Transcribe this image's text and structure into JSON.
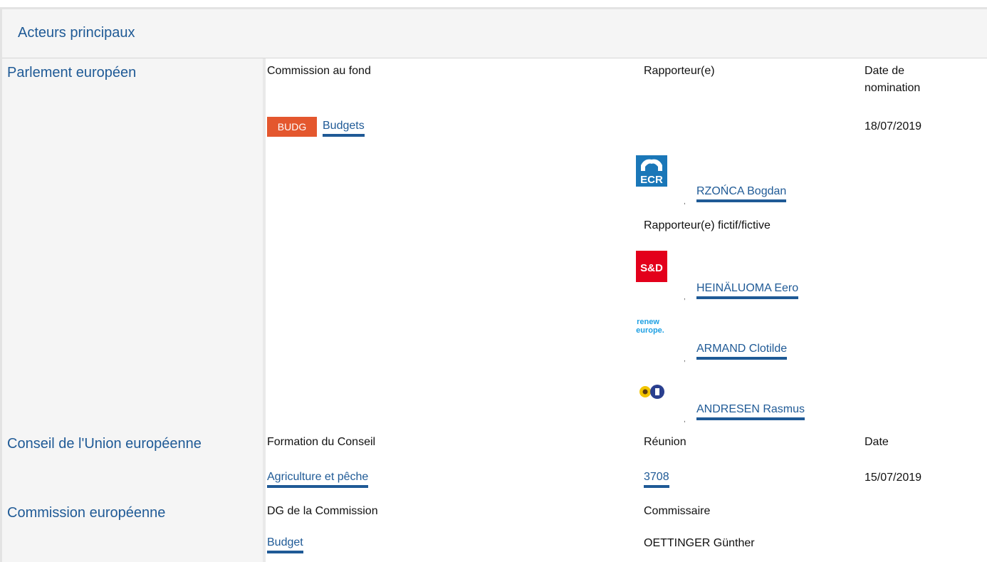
{
  "header": {
    "title": "Acteurs principaux"
  },
  "parliament": {
    "name": "Parlement européen",
    "col_committee": "Commission au fond",
    "col_rapporteur": "Rapporteur(e)",
    "col_date": "Date de\nnomination",
    "committee_badge": "BUDG",
    "committee_name": "Budgets",
    "date": "18/07/2019",
    "rapporteur": {
      "name": "RZOŃCA Bogdan",
      "group_logo": "ECR"
    },
    "shadow_label": "Rapporteur(e) fictif/fictive",
    "shadows": [
      {
        "name": "HEINÄLUOMA Eero",
        "group_logo": "S&D"
      },
      {
        "name": "ARMAND Clotilde",
        "group_logo_text": [
          "renew",
          "europe."
        ]
      },
      {
        "name": "ANDRESEN Rasmus",
        "group_logo": "greens-efa-icon"
      }
    ]
  },
  "council": {
    "name": "Conseil de l'Union européenne",
    "col_formation": "Formation du Conseil",
    "col_meeting": "Réunion",
    "col_date": "Date",
    "formation": "Agriculture et pêche",
    "meeting": "3708",
    "date": "15/07/2019"
  },
  "commission": {
    "name": "Commission européenne",
    "col_dg": "DG de la Commission",
    "col_commissioner": "Commissaire",
    "dg": "Budget",
    "commissioner": "OETTINGER Günther"
  },
  "colors": {
    "link": "#1f5a96",
    "badge": "#e4572e",
    "ecr": "#1a77b8",
    "sd": "#e3001b",
    "renew": "#1fa0e3"
  }
}
